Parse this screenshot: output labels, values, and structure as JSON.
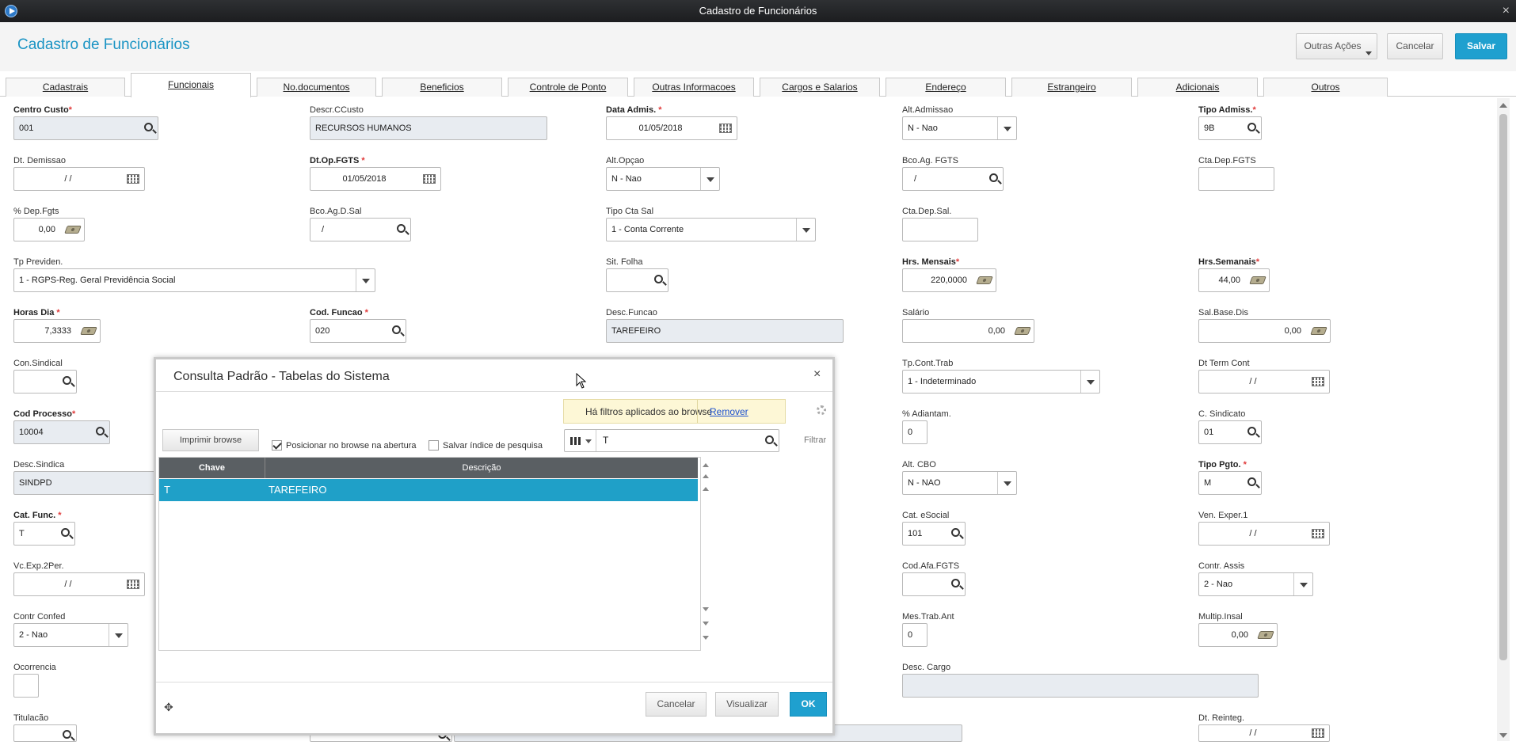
{
  "window": {
    "title": "Cadastro de Funcionários"
  },
  "header": {
    "title": "Cadastro de Funcionários",
    "other_actions": "Outras Ações",
    "cancel": "Cancelar",
    "save": "Salvar"
  },
  "tabs": [
    "Cadastrais",
    "Funcionais",
    "No.documentos",
    "Beneficios",
    "Controle de Ponto",
    "Outras Informacoes",
    "Cargos e Salarios",
    "Endereço",
    "Estrangeiro",
    "Adicionais",
    "Outros"
  ],
  "active_tab": "Funcionais",
  "fields": {
    "centro_custo": {
      "label": "Centro Custo",
      "value": "001"
    },
    "descr_ccusto": {
      "label": "Descr.CCusto",
      "value": "RECURSOS HUMANOS"
    },
    "data_admis": {
      "label": "Data Admis.",
      "value": "01/05/2018"
    },
    "alt_admissao": {
      "label": "Alt.Admissao",
      "value": "N - Nao"
    },
    "tipo_admis": {
      "label": "Tipo Admiss.",
      "value": "9B"
    },
    "dt_demissao": {
      "label": "Dt. Demissao",
      "value": "/ /"
    },
    "dt_op_fgts": {
      "label": "Dt.Op.FGTS",
      "value": "01/05/2018"
    },
    "alt_opcao": {
      "label": "Alt.Opçao",
      "value": "N - Nao"
    },
    "bco_ag_fgts": {
      "label": "Bco.Ag. FGTS",
      "value": "/"
    },
    "cta_dep_fgts": {
      "label": "Cta.Dep.FGTS",
      "value": ""
    },
    "pct_dep_fgts": {
      "label": "% Dep.Fgts",
      "value": "0,00"
    },
    "bco_ag_d_sal": {
      "label": "Bco.Ag.D.Sal",
      "value": "/"
    },
    "tipo_cta_sal": {
      "label": "Tipo Cta Sal",
      "value": "1 - Conta Corrente"
    },
    "cta_dep_sal": {
      "label": "Cta.Dep.Sal.",
      "value": ""
    },
    "tp_previden": {
      "label": "Tp Previden.",
      "value": "1 - RGPS-Reg. Geral Previdência Social"
    },
    "sit_folha": {
      "label": "Sit. Folha",
      "value": ""
    },
    "hrs_mensais": {
      "label": "Hrs. Mensais",
      "value": "220,0000"
    },
    "hrs_semanais": {
      "label": "Hrs.Semanais",
      "value": "44,00"
    },
    "horas_dia": {
      "label": "Horas Dia",
      "value": "7,3333"
    },
    "cod_funcao": {
      "label": "Cod. Funcao",
      "value": "020"
    },
    "desc_funcao": {
      "label": "Desc.Funcao",
      "value": "TAREFEIRO"
    },
    "salario": {
      "label": "Salário",
      "value": "0,00"
    },
    "sal_base_dis": {
      "label": "Sal.Base.Dis",
      "value": "0,00"
    },
    "con_sindical": {
      "label": "Con.Sindical",
      "value": ""
    },
    "tp_cont_trab": {
      "label": "Tp.Cont.Trab",
      "value": "1 - Indeterminado"
    },
    "dt_term_cont": {
      "label": "Dt Term Cont",
      "value": "/ /"
    },
    "cod_processo": {
      "label": "Cod Processo",
      "value": "10004"
    },
    "pct_adiantam": {
      "label": "% Adiantam.",
      "value": "0"
    },
    "c_sindicato": {
      "label": "C. Sindicato",
      "value": "01"
    },
    "desc_sindica": {
      "label": "Desc.Sindica",
      "value": "SINDPD"
    },
    "alt_cbo": {
      "label": "Alt. CBO",
      "value": "N - NAO"
    },
    "tipo_pgto": {
      "label": "Tipo Pgto.",
      "value": "M"
    },
    "cat_func": {
      "label": "Cat. Func.",
      "value": "T"
    },
    "cat_esocial": {
      "label": "Cat. eSocial",
      "value": "101"
    },
    "ven_exper1": {
      "label": "Ven. Exper.1",
      "value": "/ /"
    },
    "vc_exp_2per": {
      "label": "Vc.Exp.2Per.",
      "value": "/ /"
    },
    "cod_afa_fgts": {
      "label": "Cod.Afa.FGTS",
      "value": ""
    },
    "contr_assis": {
      "label": "Contr. Assis",
      "value": "2 - Nao"
    },
    "contr_confed": {
      "label": "Contr Confed",
      "value": "2 - Nao"
    },
    "mes_trab_ant": {
      "label": "Mes.Trab.Ant",
      "value": "0"
    },
    "multip_insal": {
      "label": "Multip.Insal",
      "value": "0,00"
    },
    "ocorrencia": {
      "label": "Ocorrencia",
      "value": ""
    },
    "desc_cargo": {
      "label": "Desc. Cargo",
      "value": ""
    },
    "titulacao": {
      "label": "Titulacão",
      "value": ""
    },
    "dt_reinteg": {
      "label": "Dt. Reinteg.",
      "value": "/ /"
    }
  },
  "modal": {
    "title": "Consulta Padrão - Tabelas do Sistema",
    "filter_notice": "Há filtros aplicados ao browse",
    "remove": "Remover",
    "print": "Imprimir browse",
    "position_check": "Posicionar no browse na abertura",
    "save_index": "Salvar índice de pesquisa",
    "search_value": "T",
    "filter": "Filtrar",
    "columns": [
      "Chave",
      "Descrição"
    ],
    "rows": [
      {
        "chave": "T",
        "descricao": "TAREFEIRO"
      }
    ],
    "cancel": "Cancelar",
    "view": "Visualizar",
    "ok": "OK"
  }
}
